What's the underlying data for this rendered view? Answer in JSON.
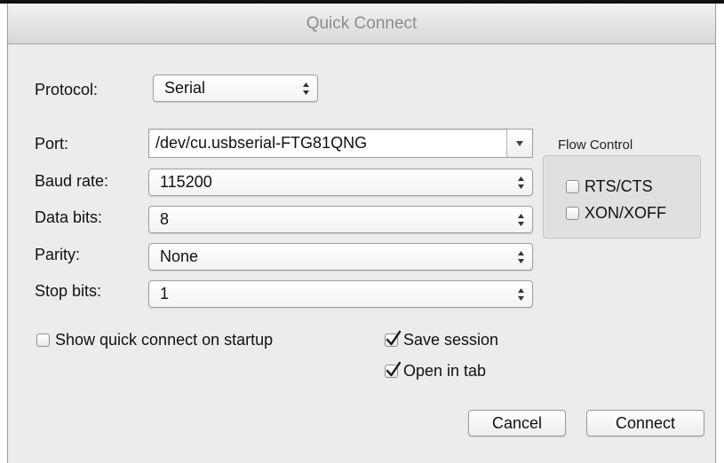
{
  "window": {
    "title": "Quick Connect"
  },
  "protocol": {
    "label": "Protocol:",
    "value": "Serial"
  },
  "port": {
    "label": "Port:",
    "value": "/dev/cu.usbserial-FTG81QNG"
  },
  "baud_rate": {
    "label": "Baud rate:",
    "value": "115200"
  },
  "data_bits": {
    "label": "Data bits:",
    "value": "8"
  },
  "parity": {
    "label": "Parity:",
    "value": "None"
  },
  "stop_bits": {
    "label": "Stop bits:",
    "value": "1"
  },
  "flow_control": {
    "title": "Flow Control",
    "rts_cts": {
      "label": "RTS/CTS",
      "checked": false
    },
    "xon_xoff": {
      "label": "XON/XOFF",
      "checked": false
    }
  },
  "options": {
    "show_on_startup": {
      "label": "Show quick connect on startup",
      "checked": false
    },
    "save_session": {
      "label": "Save session",
      "checked": true
    },
    "open_in_tab": {
      "label": "Open in tab",
      "checked": true
    }
  },
  "buttons": {
    "cancel": "Cancel",
    "connect": "Connect"
  },
  "icons": {
    "stepper": "up-down-arrows-icon",
    "dropdown": "triangle-down-icon",
    "check": "checkmark-icon"
  }
}
